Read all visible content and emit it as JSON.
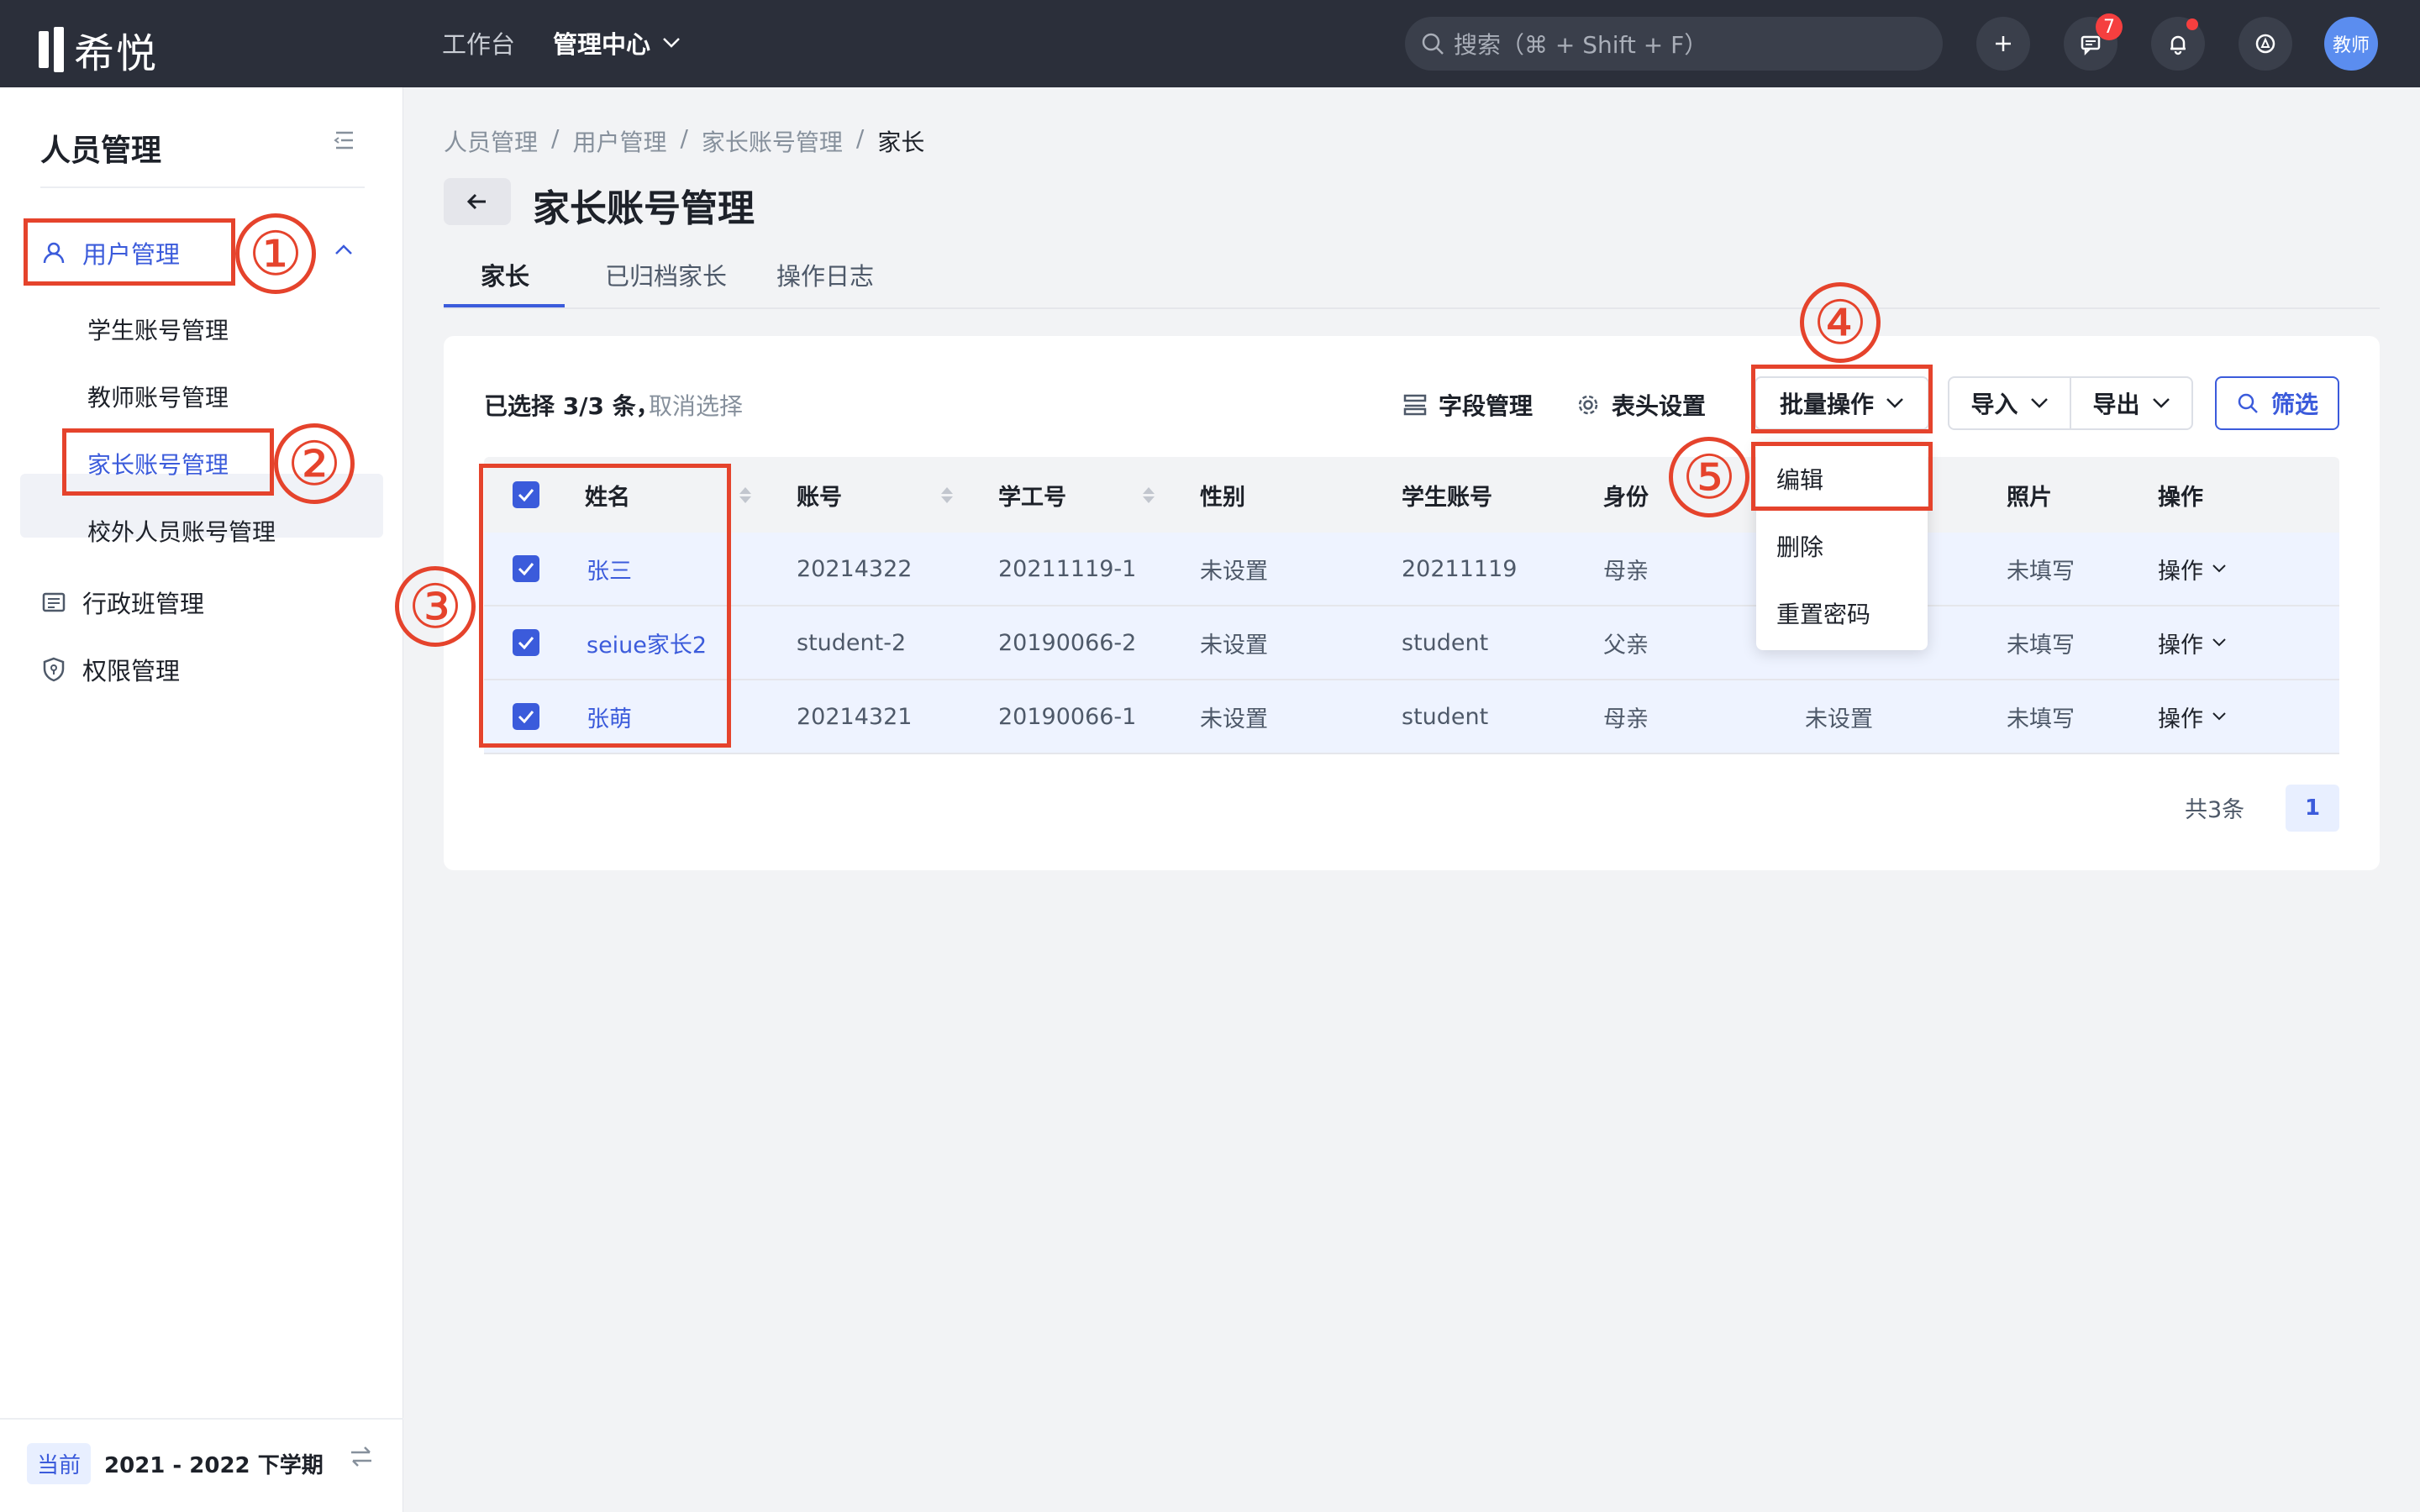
{
  "app": {
    "logo_text": "希悦"
  },
  "topnav": {
    "workbench": "工作台",
    "admin_center": "管理中心"
  },
  "search": {
    "placeholder": "搜索（⌘ + Shift + F）"
  },
  "notifications": {
    "message_count": "7"
  },
  "user": {
    "avatar_text": "教师"
  },
  "sidebar": {
    "title": "人员管理",
    "user_mgmt": "用户管理",
    "sub_items": [
      "学生账号管理",
      "教师账号管理",
      "家长账号管理",
      "校外人员账号管理"
    ],
    "class_mgmt": "行政班管理",
    "permission_mgmt": "权限管理",
    "term_chip": "当前",
    "term": "2021 - 2022 下学期"
  },
  "breadcrumb": [
    "人员管理",
    "用户管理",
    "家长账号管理",
    "家长"
  ],
  "page_title": "家长账号管理",
  "tabs": [
    "家长",
    "已归档家长",
    "操作日志"
  ],
  "toolbar": {
    "selected": "已选择 3/3 条，",
    "cancel": "取消选择",
    "field_mgmt": "字段管理",
    "header_settings": "表头设置",
    "batch_ops": "批量操作",
    "import": "导入",
    "export": "导出",
    "filter": "筛选"
  },
  "table": {
    "columns": [
      "姓名",
      "账号",
      "学工号",
      "性别",
      "学生账号",
      "身份",
      "照片",
      "操作"
    ],
    "rows": [
      [
        "张三",
        "20214322",
        "20211119-1",
        "未设置",
        "20211119",
        "母亲",
        "",
        "未填写",
        "操作"
      ],
      [
        "seiue家长2",
        "student-2",
        "20190066-2",
        "未设置",
        "student",
        "父亲",
        "",
        "未填写",
        "操作"
      ],
      [
        "张萌",
        "20214321",
        "20190066-1",
        "未设置",
        "student",
        "母亲",
        "未设置",
        "未填写",
        "操作"
      ]
    ]
  },
  "dropdown": {
    "items": [
      "编辑",
      "删除",
      "重置密码"
    ]
  },
  "pagination": {
    "total": "共3条",
    "current": "1"
  },
  "annotations": [
    "①",
    "②",
    "③",
    "④",
    "⑤"
  ],
  "colors": {
    "accent": "#3b5bdb",
    "annotation": "#e5432c",
    "topbar": "#2b2f3a"
  }
}
